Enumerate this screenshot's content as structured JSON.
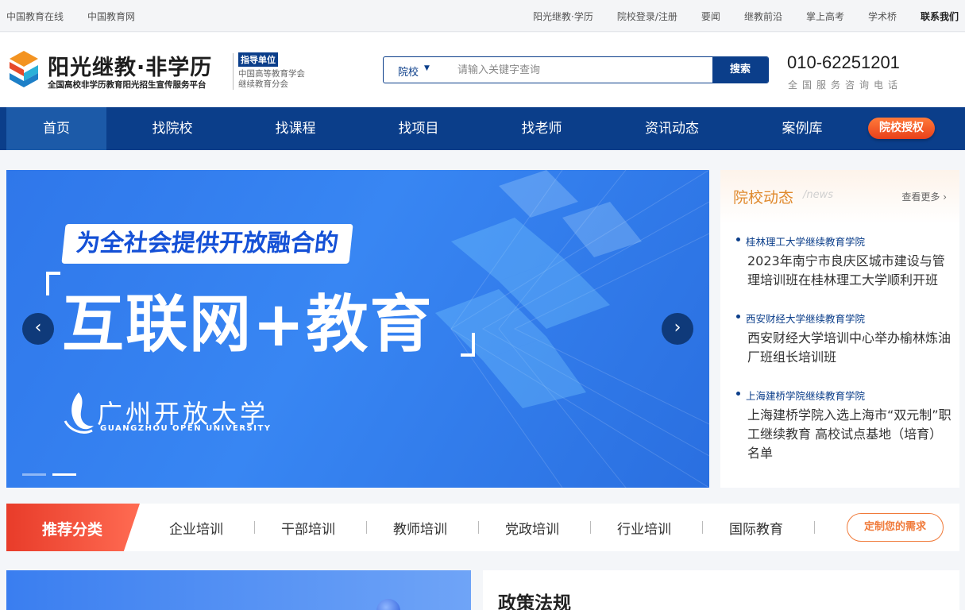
{
  "topbar": {
    "left_links": [
      "中国教育在线",
      "中国教育网"
    ],
    "right_links": [
      "阳光继教·学历",
      "院校登录/注册",
      "要闻",
      "继教前沿",
      "掌上高考",
      "学术桥",
      "联系我们"
    ]
  },
  "header": {
    "logo_title": "阳光继教·非学历",
    "logo_subtitle": "全国高校非学历教育阳光招生宣传服务平台",
    "guide_tag": "指导单位",
    "guide_org_line1": "中国高等教育学会",
    "guide_org_line2": "继续教育分会",
    "search_scope": "院校",
    "search_placeholder": "请输入关键字查询",
    "search_button": "搜索",
    "phone": "010-62251201",
    "phone_caption": "全国服务咨询电话"
  },
  "nav": {
    "items": [
      "首页",
      "找院校",
      "找课程",
      "找项目",
      "找老师",
      "资讯动态",
      "案例库"
    ],
    "active_index": 0,
    "auth_button": "院校授权"
  },
  "banner": {
    "tagline": "为全社会提供开放融合的",
    "headline": "互联网+教育",
    "university_cn": "广州开放大学",
    "university_en": "GUANGZHOU OPEN UNIVERSITY",
    "prev_label": "‹",
    "next_label": "›",
    "slide_count": 2,
    "active_slide": 1
  },
  "news": {
    "title": "院校动态",
    "title_en": "/news",
    "more": "查看更多 ›",
    "items": [
      {
        "source": "桂林理工大学继续教育学院",
        "title": "2023年南宁市良庆区城市建设与管理培训班在桂林理工大学顺利开班"
      },
      {
        "source": "西安财经大学继续教育学院",
        "title": "西安财经大学培训中心举办榆林炼油厂班组长培训班"
      },
      {
        "source": "上海建桥学院继续教育学院",
        "title": "上海建桥学院入选上海市“双元制”职工继续教育 高校试点基地（培育）名单"
      }
    ]
  },
  "categories": {
    "title": "推荐分类",
    "items": [
      "企业培训",
      "干部培训",
      "教师培训",
      "党政培训",
      "行业培训",
      "国际教育"
    ],
    "custom_button": "定制您的需求"
  },
  "policy": {
    "title": "政策法规"
  },
  "colors": {
    "primary": "#0b3e8a",
    "accent_orange": "#e08a2e",
    "accent_red": "#e83c2a"
  }
}
